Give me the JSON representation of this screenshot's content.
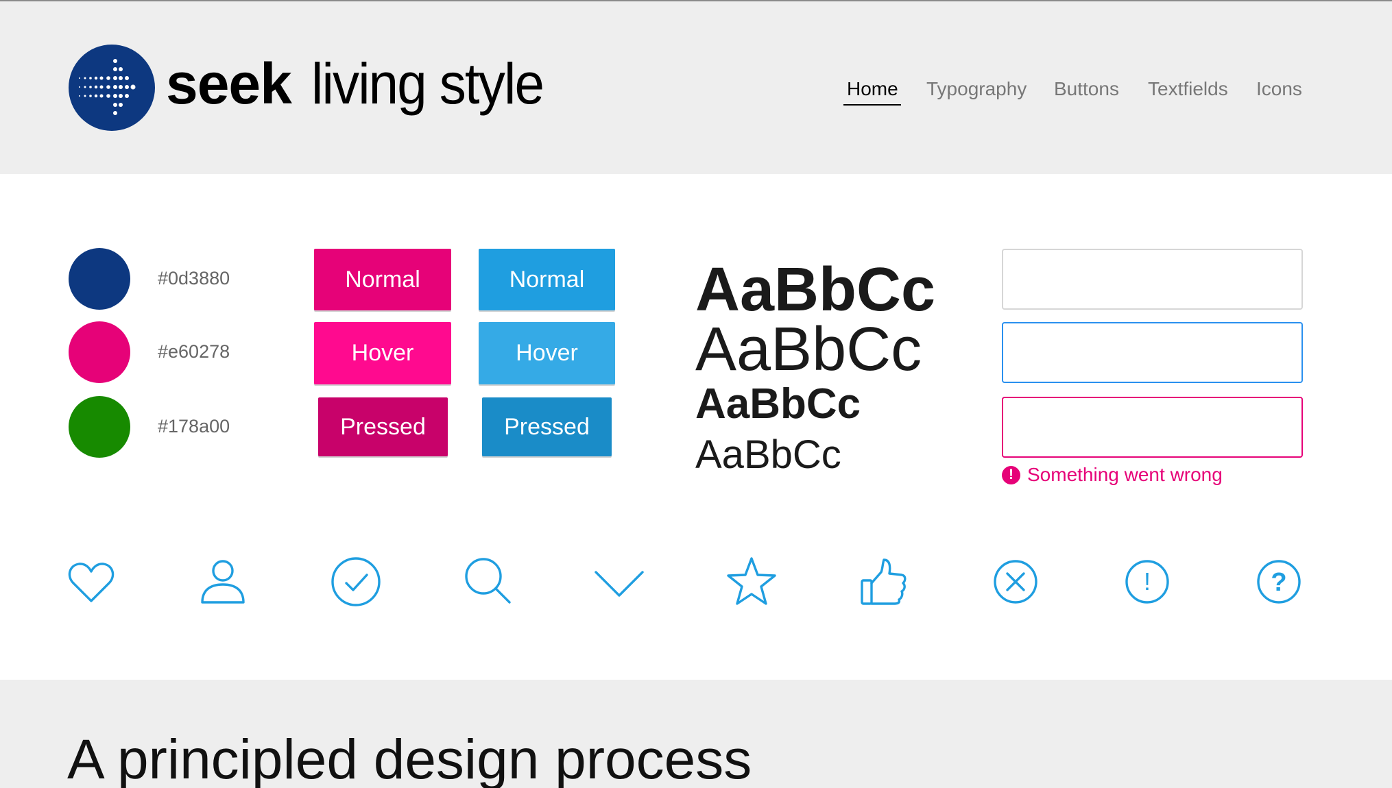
{
  "brand": {
    "name": "seek",
    "subtitle": "living style"
  },
  "nav": {
    "items": [
      {
        "label": "Home",
        "active": true
      },
      {
        "label": "Typography"
      },
      {
        "label": "Buttons"
      },
      {
        "label": "Textfields"
      },
      {
        "label": "Icons"
      }
    ]
  },
  "colors": [
    {
      "hex": "#0d3880"
    },
    {
      "hex": "#e60278"
    },
    {
      "hex": "#178a00"
    }
  ],
  "buttons": {
    "pink": {
      "normal": "Normal",
      "hover": "Hover",
      "pressed": "Pressed"
    },
    "blue": {
      "normal": "Normal",
      "hover": "Hover",
      "pressed": "Pressed"
    }
  },
  "typography": {
    "samples": [
      "AaBbCc",
      "AaBbCc",
      "AaBbCc",
      "AaBbCc"
    ]
  },
  "textfields": {
    "error_message": "Something went wrong",
    "error_icon": "!"
  },
  "icons": [
    "heart-icon",
    "user-icon",
    "check-circle-icon",
    "search-icon",
    "chevron-down-icon",
    "star-icon",
    "thumbs-up-icon",
    "close-circle-icon",
    "alert-circle-icon",
    "help-circle-icon"
  ],
  "icon_glyphs": {
    "alert": "!",
    "help": "?"
  },
  "section": {
    "heading": "A principled design process"
  },
  "accent": {
    "blue": "#1f9ee0",
    "pink": "#e60278",
    "navy": "#0d3880",
    "green": "#178a00"
  }
}
